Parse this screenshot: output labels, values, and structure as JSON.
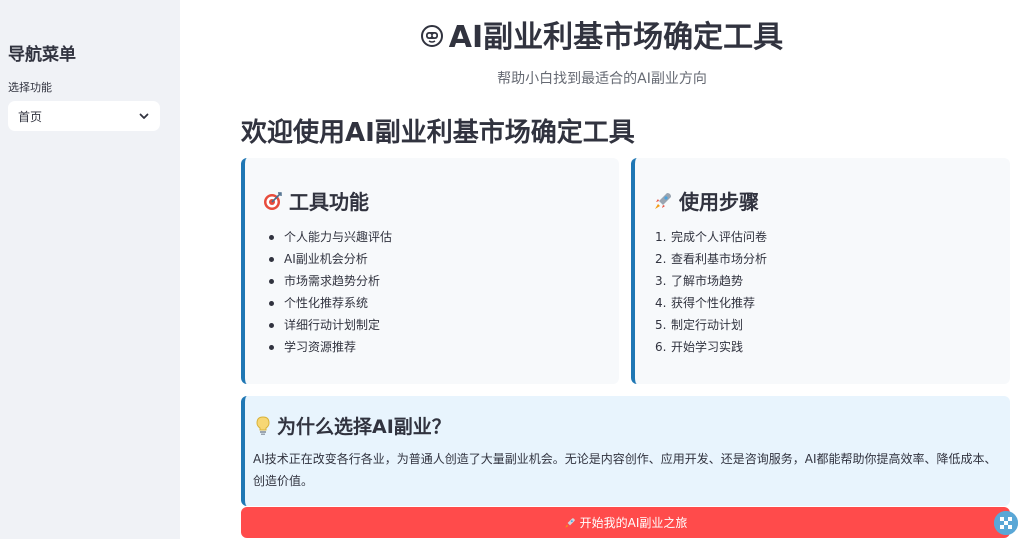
{
  "sidebar": {
    "title": "导航菜单",
    "select_label": "选择功能",
    "select_value": "首页"
  },
  "header": {
    "title": "AI副业利基市场确定工具",
    "subtitle": "帮助小白找到最适合的AI副业方向"
  },
  "welcome": "欢迎使用AI副业利基市场确定工具",
  "features_card": {
    "title": "工具功能",
    "items": [
      "个人能力与兴趣评估",
      "AI副业机会分析",
      "市场需求趋势分析",
      "个性化推荐系统",
      "详细行动计划制定",
      "学习资源推荐"
    ]
  },
  "steps_card": {
    "title": "使用步骤",
    "numbers": [
      "1.",
      "2.",
      "3.",
      "4.",
      "5.",
      "6."
    ],
    "items": [
      "完成个人评估问卷",
      "查看利基市场分析",
      "了解市场趋势",
      "获得个性化推荐",
      "制定行动计划",
      "开始学习实践"
    ]
  },
  "why_section": {
    "title": "为什么选择AI副业？",
    "body": "AI技术正在改变各行各业，为普通人创造了大量副业机会。无论是内容创作、应用开发、还是咨询服务，AI都能帮助你提高效率、降低成本、创造价值。"
  },
  "start_button": {
    "label": "开始我的AI副业之旅"
  },
  "colors": {
    "accent": "#1f77b4",
    "button": "#ff4b4b",
    "sidebar_bg": "#f0f2f6",
    "card_bg": "#f7f9fb",
    "info_bg": "#e8f4fd"
  },
  "icons": [
    "robot-icon",
    "target-icon",
    "rocket-icon",
    "lightbulb-icon",
    "chevron-down-icon"
  ]
}
